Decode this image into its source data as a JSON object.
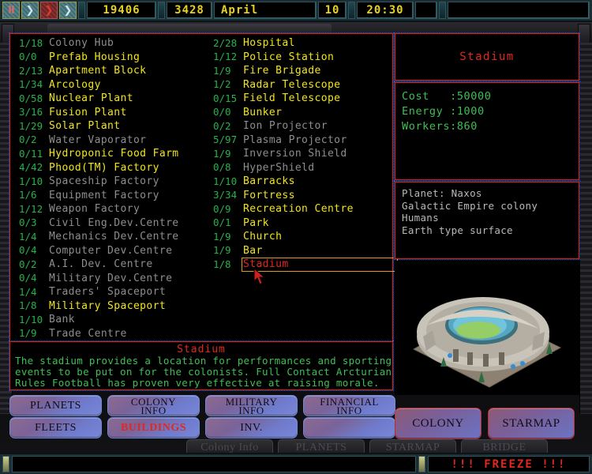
{
  "topbar": {
    "controls": [
      {
        "name": "pause-button",
        "glyph": "II",
        "style": "pause"
      },
      {
        "name": "play-button",
        "glyph": "❯",
        "style": "fwd"
      },
      {
        "name": "fast-forward-button",
        "glyph": "❯",
        "style": "fwdred"
      },
      {
        "name": "turbo-button",
        "glyph": "❯",
        "style": "fwd"
      }
    ],
    "year": "19406",
    "credits": "3428",
    "month": "April",
    "day": "10",
    "time": "20:30"
  },
  "buildings": {
    "column_left": [
      {
        "qty": "1/18",
        "name": "Colony Hub",
        "state": "off"
      },
      {
        "qty": "0/0",
        "name": "Prefab Housing",
        "state": "on"
      },
      {
        "qty": "2/13",
        "name": "Apartment Block",
        "state": "on"
      },
      {
        "qty": "1/34",
        "name": "Arcology",
        "state": "on"
      },
      {
        "qty": "0/58",
        "name": "Nuclear Plant",
        "state": "on"
      },
      {
        "qty": "3/16",
        "name": "Fusion Plant",
        "state": "on"
      },
      {
        "qty": "1/29",
        "name": "Solar Plant",
        "state": "on"
      },
      {
        "qty": "0/2",
        "name": "Water Vaporator",
        "state": "off"
      },
      {
        "qty": "0/11",
        "name": "Hydroponic Food Farm",
        "state": "on"
      },
      {
        "qty": "4/42",
        "name": "Phood(TM) Factory",
        "state": "on"
      },
      {
        "qty": "1/10",
        "name": "Spaceship Factory",
        "state": "off"
      },
      {
        "qty": "1/6",
        "name": "Equipment Factory",
        "state": "off"
      },
      {
        "qty": "1/12",
        "name": "Weapon Factory",
        "state": "off"
      },
      {
        "qty": "0/3",
        "name": "Civil Eng.Dev.Centre",
        "state": "off"
      },
      {
        "qty": "1/4",
        "name": "Mechanics Dev.Centre",
        "state": "off"
      },
      {
        "qty": "0/4",
        "name": "Computer Dev.Centre",
        "state": "off"
      },
      {
        "qty": "0/2",
        "name": "A.I. Dev. Centre",
        "state": "off"
      },
      {
        "qty": "0/4",
        "name": "Military Dev.Centre",
        "state": "off"
      },
      {
        "qty": "1/4",
        "name": "Traders' Spaceport",
        "state": "off"
      },
      {
        "qty": "1/8",
        "name": "Military Spaceport",
        "state": "on"
      },
      {
        "qty": "1/10",
        "name": "Bank",
        "state": "off"
      },
      {
        "qty": "1/9",
        "name": "Trade Centre",
        "state": "off"
      }
    ],
    "column_right": [
      {
        "qty": "2/28",
        "name": "Hospital",
        "state": "on"
      },
      {
        "qty": "1/12",
        "name": "Police Station",
        "state": "on"
      },
      {
        "qty": "1/9",
        "name": "Fire Brigade",
        "state": "on"
      },
      {
        "qty": "1/2",
        "name": "Radar Telescope",
        "state": "on"
      },
      {
        "qty": "0/15",
        "name": "Field Telescope",
        "state": "on"
      },
      {
        "qty": "0/0",
        "name": "Bunker",
        "state": "on"
      },
      {
        "qty": "0/2",
        "name": "Ion Projector",
        "state": "off"
      },
      {
        "qty": "5/97",
        "name": "Plasma Projector",
        "state": "off"
      },
      {
        "qty": "1/9",
        "name": "Inversion Shield",
        "state": "off"
      },
      {
        "qty": "0/8",
        "name": "HyperShield",
        "state": "off"
      },
      {
        "qty": "1/10",
        "name": "Barracks",
        "state": "on"
      },
      {
        "qty": "3/34",
        "name": "Fortress",
        "state": "on"
      },
      {
        "qty": "0/9",
        "name": "Recreation Centre",
        "state": "on"
      },
      {
        "qty": "0/1",
        "name": "Park",
        "state": "on"
      },
      {
        "qty": "1/9",
        "name": "Church",
        "state": "on"
      },
      {
        "qty": "1/9",
        "name": "Bar",
        "state": "on"
      },
      {
        "qty": "1/8",
        "name": "Stadium",
        "state": "selected"
      }
    ]
  },
  "description": {
    "title": "Stadium",
    "lines": [
      "The stadium provides a location for performances and sporting",
      "events to be put on for the colonists. Full Contact Arcturian",
      "Rules Football has proven very effective at raising morale."
    ]
  },
  "info": {
    "title": "Stadium",
    "stats": [
      "Cost   :50000",
      "Energy :1000",
      "Workers:860"
    ],
    "planet": [
      "Planet: Naxos",
      "Galactic Empire colony",
      "Humans",
      "Earth type surface"
    ]
  },
  "buttons": {
    "row1": [
      {
        "name": "planets-button",
        "line1": "PLANETS",
        "line2": "",
        "active": false
      },
      {
        "name": "colony-info-button",
        "line1": "COLONY",
        "line2": "INFO",
        "active": false
      },
      {
        "name": "military-info-button",
        "line1": "MILITARY",
        "line2": "INFO",
        "active": false
      },
      {
        "name": "financial-info-button",
        "line1": "FINANCIAL",
        "line2": "INFO",
        "active": false
      }
    ],
    "row2": [
      {
        "name": "fleets-button",
        "line1": "FLEETS",
        "line2": "",
        "active": false
      },
      {
        "name": "buildings-button",
        "line1": "BUILDINGS",
        "line2": "",
        "active": true
      },
      {
        "name": "inventory-button",
        "line1": "INV.",
        "line2": "",
        "active": false
      },
      {
        "name": "blank-button",
        "line1": "",
        "line2": "",
        "active": false
      }
    ],
    "right": [
      {
        "name": "colony-button",
        "label": "COLONY"
      },
      {
        "name": "starmap-button",
        "label": "STARMAP"
      }
    ],
    "background": [
      {
        "name": "bg-colony-info-button",
        "label": "Colony Info"
      },
      {
        "name": "bg-planets-button",
        "label": "PLANETS"
      },
      {
        "name": "bg-starmap-button",
        "label": "STARMAP"
      },
      {
        "name": "bg-bridge-button",
        "label": "BRIDGE"
      }
    ]
  },
  "status": {
    "message": "",
    "alert": "!!! FREEZE !!!"
  },
  "colors": {
    "accent_red": "#e02820",
    "yellow": "#f2e41c",
    "green": "#3fbf55",
    "grey": "#8e8e8e",
    "select_border": "#e09a18"
  }
}
